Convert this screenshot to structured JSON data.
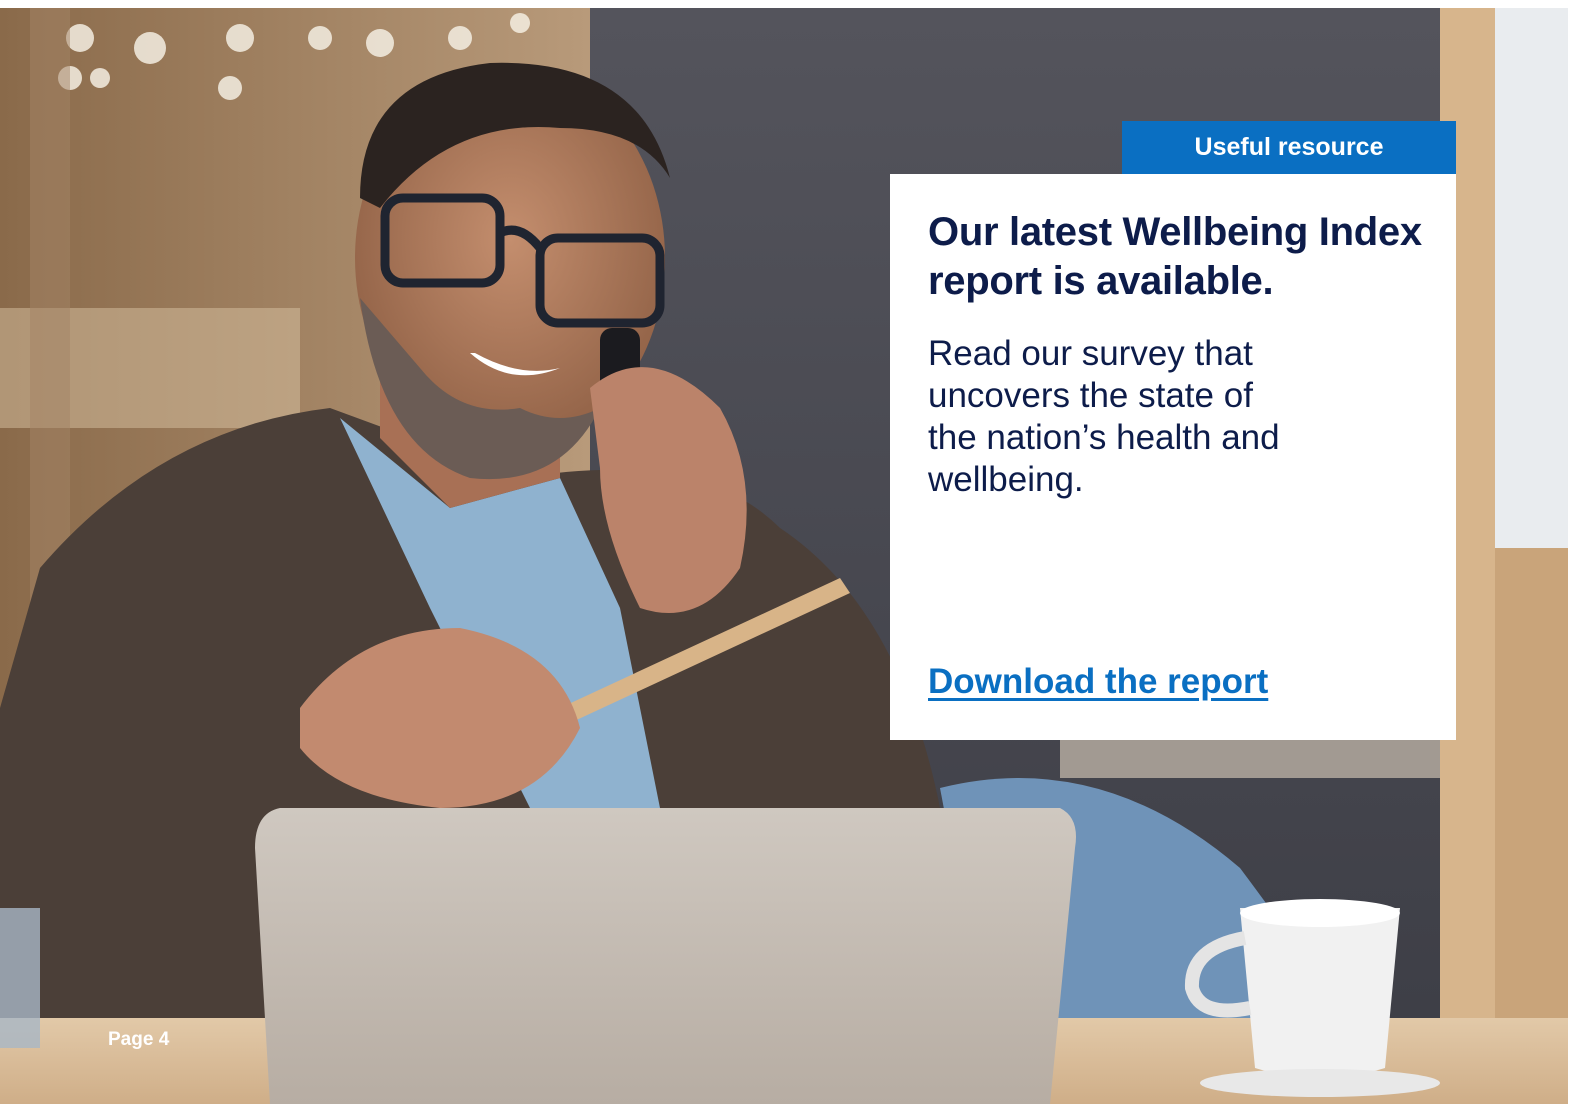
{
  "badge": {
    "label": "Useful resource"
  },
  "card": {
    "title": "Our latest Wellbeing Index report is available.",
    "body": "Read our survey that uncovers the state of the nation’s health and wellbeing.",
    "link_label": "Download the report"
  },
  "footer": {
    "page_label": "Page 4"
  },
  "colors": {
    "accent_blue": "#0a6fc2",
    "heading_navy": "#0d1c4a"
  }
}
